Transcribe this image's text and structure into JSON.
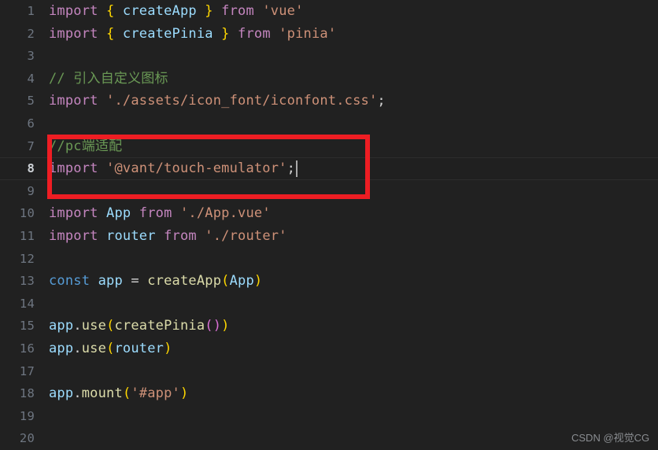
{
  "editor": {
    "background_color": "#212121",
    "active_line": 8,
    "total_lines_visible": 20,
    "lines": [
      {
        "number": "1",
        "text": "import { createApp } from 'vue'"
      },
      {
        "number": "2",
        "text": "import { createPinia } from 'pinia'"
      },
      {
        "number": "3",
        "text": ""
      },
      {
        "number": "4",
        "text": "// 引入自定义图标"
      },
      {
        "number": "5",
        "text": "import './assets/icon_font/iconfont.css';"
      },
      {
        "number": "6",
        "text": ""
      },
      {
        "number": "7",
        "text": "//pc端适配"
      },
      {
        "number": "8",
        "text": "import '@vant/touch-emulator';"
      },
      {
        "number": "9",
        "text": ""
      },
      {
        "number": "10",
        "text": "import App from './App.vue'"
      },
      {
        "number": "11",
        "text": "import router from './router'"
      },
      {
        "number": "12",
        "text": ""
      },
      {
        "number": "13",
        "text": "const app = createApp(App)"
      },
      {
        "number": "14",
        "text": ""
      },
      {
        "number": "15",
        "text": "app.use(createPinia())"
      },
      {
        "number": "16",
        "text": "app.use(router)"
      },
      {
        "number": "17",
        "text": ""
      },
      {
        "number": "18",
        "text": "app.mount('#app')"
      },
      {
        "number": "19",
        "text": ""
      },
      {
        "number": "20",
        "text": ""
      }
    ],
    "line_numbers": [
      "1",
      "2",
      "3",
      "4",
      "5",
      "6",
      "7",
      "8",
      "9",
      "10",
      "11",
      "12",
      "13",
      "14",
      "15",
      "16",
      "17",
      "18",
      "19",
      "20"
    ]
  },
  "tokens": {
    "line1": {
      "kw_import": "import",
      "brace_open": "{",
      "name": "createApp",
      "brace_close": "}",
      "kw_from": "from",
      "module": "'vue'"
    },
    "line2": {
      "kw_import": "import",
      "brace_open": "{",
      "name": "createPinia",
      "brace_close": "}",
      "kw_from": "from",
      "module": "'pinia'"
    },
    "line4": {
      "comment": "// 引入自定义图标"
    },
    "line5": {
      "kw_import": "import",
      "module": "'./assets/icon_font/iconfont.css'",
      "semi": ";"
    },
    "line7": {
      "comment": "//pc端适配"
    },
    "line8": {
      "kw_import": "import",
      "module": "'@vant/touch-emulator'",
      "semi": ";"
    },
    "line10": {
      "kw_import": "import",
      "name": "App",
      "kw_from": "from",
      "module": "'./App.vue'"
    },
    "line11": {
      "kw_import": "import",
      "name": "router",
      "kw_from": "from",
      "module": "'./router'"
    },
    "line13": {
      "kw_const": "const",
      "name": "app",
      "equals": "=",
      "fn": "createApp",
      "paren_open": "(",
      "arg": "App",
      "paren_close": ")"
    },
    "line15": {
      "obj": "app",
      "dot": ".",
      "method": "use",
      "paren_open": "(",
      "fn": "createPinia",
      "inner_open": "(",
      "inner_close": ")",
      "paren_close": ")"
    },
    "line16": {
      "obj": "app",
      "dot": ".",
      "method": "use",
      "paren_open": "(",
      "arg": "router",
      "paren_close": ")"
    },
    "line18": {
      "obj": "app",
      "dot": ".",
      "method": "mount",
      "paren_open": "(",
      "arg": "'#app'",
      "paren_close": ")"
    }
  },
  "annotation": {
    "type": "rectangle-highlight",
    "color": "#ee1d23",
    "covers_lines": "7-9"
  },
  "caret": {
    "line": 8,
    "after_text": "import '@vant/touch-emulator';"
  },
  "watermark": {
    "text": "CSDN @视觉CG"
  },
  "colors": {
    "background": "#212121",
    "line_number": "#6e7681",
    "active_line_number": "#cfd3d8",
    "keyword": "#c586c0",
    "declaration": "#569cd6",
    "variable": "#9cdcfe",
    "string": "#ce9178",
    "comment": "#6a9955",
    "function": "#dcdcaa",
    "bracket_yellow": "#ffd700",
    "bracket_purple": "#da70d6",
    "plain": "#d4d4d4",
    "annotation_red": "#ee1d23"
  }
}
